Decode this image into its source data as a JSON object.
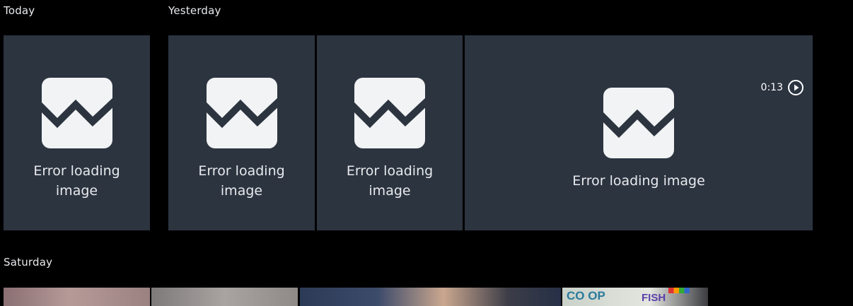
{
  "groups": {
    "today": {
      "label": "Today"
    },
    "yesterday": {
      "label": "Yesterday"
    },
    "saturday": {
      "label": "Saturday"
    }
  },
  "tiles": {
    "t1": {
      "error_text": "Error loading image"
    },
    "t2": {
      "error_text": "Error loading image"
    },
    "t3": {
      "error_text": "Error loading image"
    },
    "t4": {
      "error_text": "Error loading image",
      "duration": "0:13"
    }
  },
  "saturday_photos": {
    "p4_sign_text_1": "CO OP",
    "p4_sign_text_2": "FISH"
  },
  "colors": {
    "background": "#000000",
    "tile_bg": "#2c3440",
    "icon_fill": "#f1f3f4",
    "text": "#e8eaed"
  }
}
